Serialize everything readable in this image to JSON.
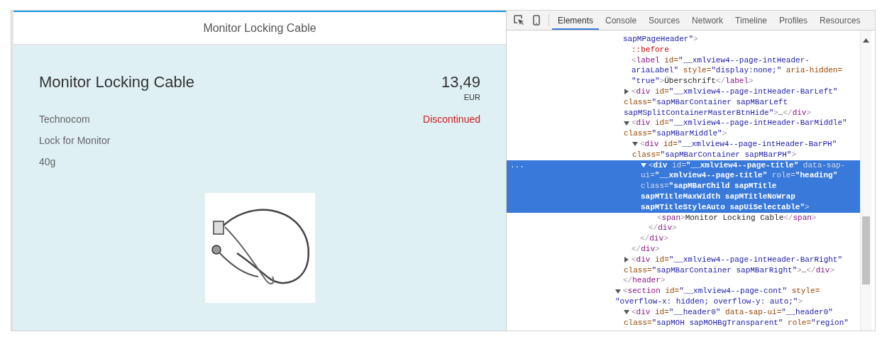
{
  "app": {
    "header_title": "Monitor Locking Cable",
    "object": {
      "title": "Monitor Locking Cable",
      "price": "13,49",
      "currency": "EUR",
      "attributes": [
        "Technocom",
        "Lock for Monitor",
        "40g"
      ],
      "status": {
        "text": "Discontinued"
      }
    }
  },
  "devtools": {
    "tabs": [
      {
        "label": "Elements",
        "selected": true
      },
      {
        "label": "Console",
        "selected": false
      },
      {
        "label": "Sources",
        "selected": false
      },
      {
        "label": "Network",
        "selected": false
      },
      {
        "label": "Timeline",
        "selected": false
      },
      {
        "label": "Profiles",
        "selected": false
      },
      {
        "label": "Resources",
        "selected": false
      }
    ],
    "selected_marker": "...",
    "tree": [
      {
        "continued": true,
        "expanded": true,
        "lines": [
          "sapMPageHeader\">"
        ],
        "closing": "</header>",
        "children": [
          {
            "kind": "pseudo",
            "lines": [
              "::before"
            ]
          },
          {
            "lines": [
              "<label id=\"__xmlview4--page-intHeader-",
              "ariaLabel\" style=\"display:none;\" aria-hidden=",
              "\"true\">Überschrift</label>"
            ]
          },
          {
            "expanded": false,
            "lines": [
              "<div id=\"__xmlview4--page-intHeader-BarLeft\"",
              "class=\"sapMBarContainer sapMBarLeft",
              "sapMSplitContainerMasterBtnHide\">…</div>"
            ]
          },
          {
            "expanded": true,
            "lines": [
              "<div id=\"__xmlview4--page-intHeader-BarMiddle\"",
              "class=\"sapMBarMiddle\">"
            ],
            "closing": "</div>",
            "children": [
              {
                "expanded": true,
                "lines": [
                  "<div id=\"__xmlview4--page-intHeader-BarPH\"",
                  "class=\"sapMBarContainer sapMBarPH\">"
                ],
                "closing": "</div>",
                "children": [
                  {
                    "expanded": true,
                    "selected": true,
                    "lines": [
                      "<div id=\"__xmlview4--page-title\" data-sap-",
                      "ui=\"__xmlview4--page-title\" role=\"heading\"",
                      "class=\"sapMBarChild sapMTitle",
                      "sapMTitleMaxWidth sapMTitleNoWrap",
                      "sapMTitleStyleAuto sapUiSelectable\">"
                    ],
                    "closing": "</div>",
                    "children": [
                      {
                        "lines": [
                          "<span>Monitor Locking Cable</span>"
                        ]
                      }
                    ]
                  }
                ]
              }
            ]
          },
          {
            "expanded": false,
            "lines": [
              "<div id=\"__xmlview4--page-intHeader-BarRight\"",
              "class=\"sapMBarContainer sapMBarRight\">…</div>"
            ]
          }
        ]
      },
      {
        "expanded": true,
        "lines": [
          "<section id=\"__xmlview4--page-cont\" style=",
          "\"overflow-x: hidden; overflow-y: auto;\">"
        ],
        "children": [
          {
            "expanded": true,
            "lines": [
              "<div id=\"__header0\" data-sap-ui=\"__header0\"",
              "class=\"sapMOH sapMOHBgTransparent\" role=\"region\""
            ]
          }
        ]
      }
    ]
  }
}
